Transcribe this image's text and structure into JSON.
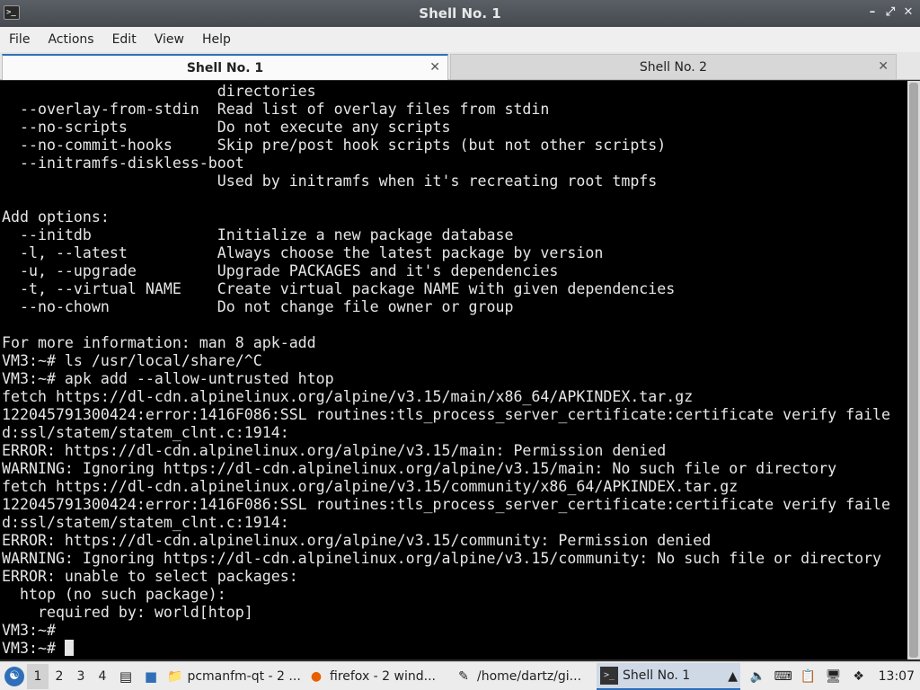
{
  "window": {
    "title": "Shell No. 1",
    "app_icon": "terminal-icon",
    "controls": [
      "minimize",
      "maximize",
      "close"
    ]
  },
  "menu": [
    "File",
    "Actions",
    "Edit",
    "View",
    "Help"
  ],
  "tabs": [
    {
      "label": "Shell No. 1",
      "active": true
    },
    {
      "label": "Shell No. 2",
      "active": false
    }
  ],
  "terminal": {
    "lines": [
      "                        directories",
      "  --overlay-from-stdin  Read list of overlay files from stdin",
      "  --no-scripts          Do not execute any scripts",
      "  --no-commit-hooks     Skip pre/post hook scripts (but not other scripts)",
      "  --initramfs-diskless-boot",
      "                        Used by initramfs when it's recreating root tmpfs",
      "",
      "Add options:",
      "  --initdb              Initialize a new package database",
      "  -l, --latest          Always choose the latest package by version",
      "  -u, --upgrade         Upgrade PACKAGES and it's dependencies",
      "  -t, --virtual NAME    Create virtual package NAME with given dependencies",
      "  --no-chown            Do not change file owner or group",
      "",
      "For more information: man 8 apk-add",
      "VM3:~# ls /usr/local/share/^C",
      "VM3:~# apk add --allow-untrusted htop",
      "fetch https://dl-cdn.alpinelinux.org/alpine/v3.15/main/x86_64/APKINDEX.tar.gz",
      "122045791300424:error:1416F086:SSL routines:tls_process_server_certificate:certificate verify faile",
      "d:ssl/statem/statem_clnt.c:1914:",
      "ERROR: https://dl-cdn.alpinelinux.org/alpine/v3.15/main: Permission denied",
      "WARNING: Ignoring https://dl-cdn.alpinelinux.org/alpine/v3.15/main: No such file or directory",
      "fetch https://dl-cdn.alpinelinux.org/alpine/v3.15/community/x86_64/APKINDEX.tar.gz",
      "122045791300424:error:1416F086:SSL routines:tls_process_server_certificate:certificate verify faile",
      "d:ssl/statem/statem_clnt.c:1914:",
      "ERROR: https://dl-cdn.alpinelinux.org/alpine/v3.15/community: Permission denied",
      "WARNING: Ignoring https://dl-cdn.alpinelinux.org/alpine/v3.15/community: No such file or directory",
      "ERROR: unable to select packages:",
      "  htop (no such package):",
      "    required by: world[htop]",
      "VM3:~#",
      "VM3:~# "
    ]
  },
  "taskbar": {
    "workspaces": [
      "1",
      "2",
      "3",
      "4"
    ],
    "active_workspace": "1",
    "tasks": [
      {
        "label": "pcmanfm-qt - 2 ...",
        "icon": "folder-icon",
        "active": false
      },
      {
        "label": "firefox - 2 wind...",
        "icon": "firefox-icon",
        "active": false
      },
      {
        "label": "/home/dartz/gi...",
        "icon": "editor-icon",
        "active": false
      },
      {
        "label": "Shell No. 1",
        "icon": "terminal-icon",
        "active": true
      }
    ],
    "clock": "13:07",
    "accent": "#2f6fb8"
  }
}
